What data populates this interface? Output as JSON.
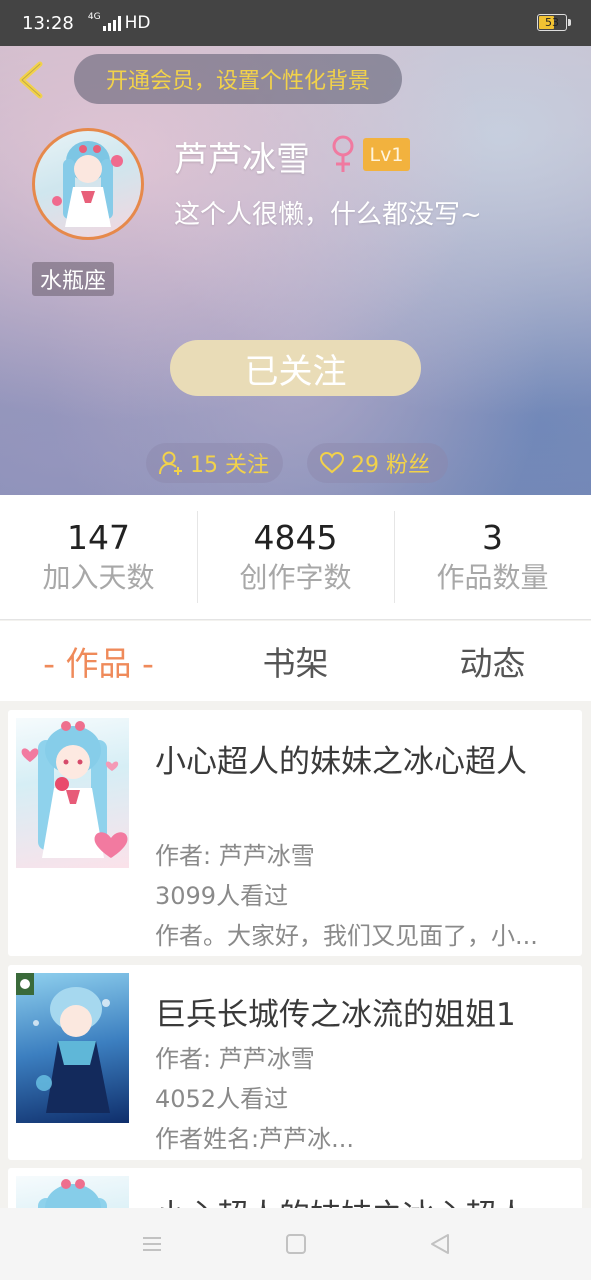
{
  "status_bar": {
    "time": "13:28",
    "network": "4G",
    "hd": "HD",
    "battery": "53"
  },
  "header": {
    "vip_banner": "开通会员，设置个性化背景",
    "username": "芦芦冰雪",
    "level": "Lv1",
    "bio": "这个人很懒，什么都没写~",
    "zodiac": "水瓶座",
    "follow_button": "已关注",
    "following_label": "15 关注",
    "fans_label": "29 粉丝",
    "accent_color": "#f2d24a"
  },
  "stats": [
    {
      "value": "147",
      "label": "加入天数"
    },
    {
      "value": "4845",
      "label": "创作字数"
    },
    {
      "value": "3",
      "label": "作品数量"
    }
  ],
  "tabs": [
    {
      "label": "- 作品 -",
      "active": true
    },
    {
      "label": "书架",
      "active": false
    },
    {
      "label": "动态",
      "active": false
    }
  ],
  "books": [
    {
      "title": "小心超人的妹妹之冰心超人",
      "author": "作者: 芦芦冰雪",
      "views": "3099人看过",
      "desc": "作者。大家好，我们又见面了，小..."
    },
    {
      "title": "巨兵长城传之冰流的姐姐1",
      "author": "作者: 芦芦冰雪",
      "views": "4052人看过",
      "desc": "作者姓名:芦芦冰..."
    },
    {
      "title": "小心超人的妹妹之冰心超人"
    }
  ]
}
